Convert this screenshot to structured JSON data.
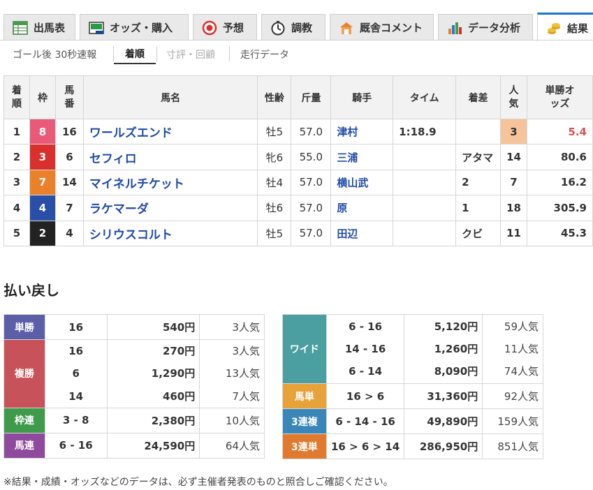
{
  "tabs": [
    {
      "label": "出馬表",
      "icon": "table-icon"
    },
    {
      "label": "オッズ・購入",
      "icon": "ipat-icon"
    },
    {
      "label": "予想",
      "icon": "target-icon"
    },
    {
      "label": "調教",
      "icon": "stopwatch-icon"
    },
    {
      "label": "厩舎コメント",
      "icon": "stable-icon"
    },
    {
      "label": "データ分析",
      "icon": "bar-chart-icon"
    },
    {
      "label": "結果",
      "icon": "coins-icon"
    }
  ],
  "subtabs": [
    "ゴール後 30秒速報",
    "着順",
    "寸評・回顧",
    "走行データ"
  ],
  "result_table": {
    "headers": [
      "着順",
      "枠",
      "馬番",
      "馬名",
      "性齢",
      "斤量",
      "騎手",
      "タイム",
      "着差",
      "人気",
      "単勝オッズ"
    ],
    "rows": [
      {
        "rank": "1",
        "waku": "8",
        "waku_color": "#e85a77",
        "num": "16",
        "name": "ワールズエンド",
        "sexage": "牡5",
        "weight": "57.0",
        "jockey": "津村",
        "time": "1:18.9",
        "margin": "",
        "pop": "3",
        "odds": "5.4"
      },
      {
        "rank": "2",
        "waku": "3",
        "waku_color": "#d9302e",
        "num": "6",
        "name": "セフィロ",
        "sexage": "牝6",
        "weight": "55.0",
        "jockey": "三浦",
        "time": "",
        "margin": "アタマ",
        "pop": "14",
        "odds": "80.6"
      },
      {
        "rank": "3",
        "waku": "7",
        "waku_color": "#e9812a",
        "num": "14",
        "name": "マイネルチケット",
        "sexage": "牡4",
        "weight": "57.0",
        "jockey": "横山武",
        "time": "",
        "margin": "2",
        "pop": "7",
        "odds": "16.2"
      },
      {
        "rank": "4",
        "waku": "4",
        "waku_color": "#2a4fa6",
        "num": "7",
        "name": "ラケマーダ",
        "sexage": "牡6",
        "weight": "57.0",
        "jockey": "原",
        "time": "",
        "margin": "1",
        "pop": "18",
        "odds": "305.9"
      },
      {
        "rank": "5",
        "waku": "2",
        "waku_color": "#222222",
        "num": "4",
        "name": "シリウスコルト",
        "sexage": "牡5",
        "weight": "57.0",
        "jockey": "田辺",
        "time": "",
        "margin": "クビ",
        "pop": "11",
        "odds": "45.3"
      }
    ]
  },
  "payout": {
    "title": "払い戻し",
    "left": [
      {
        "label": "単勝",
        "color": "#5b5fa8",
        "entries": [
          {
            "combo": "16",
            "amount": "540円",
            "pop": "3人気"
          }
        ]
      },
      {
        "label": "複勝",
        "color": "#c8525a",
        "entries": [
          {
            "combo": "16",
            "amount": "270円",
            "pop": "3人気"
          },
          {
            "combo": "6",
            "amount": "1,290円",
            "pop": "13人気"
          },
          {
            "combo": "14",
            "amount": "460円",
            "pop": "7人気"
          }
        ]
      },
      {
        "label": "枠連",
        "color": "#3f9a4b",
        "entries": [
          {
            "combo": "3 - 8",
            "amount": "2,380円",
            "pop": "10人気"
          }
        ]
      },
      {
        "label": "馬連",
        "color": "#8e4a9c",
        "entries": [
          {
            "combo": "6 - 16",
            "amount": "24,590円",
            "pop": "64人気"
          }
        ]
      }
    ],
    "right": [
      {
        "label": "ワイド",
        "color": "#4b9fa0",
        "entries": [
          {
            "combo": "6 - 16",
            "amount": "5,120円",
            "pop": "59人気"
          },
          {
            "combo": "14 - 16",
            "amount": "1,260円",
            "pop": "11人気"
          },
          {
            "combo": "6 - 14",
            "amount": "8,090円",
            "pop": "74人気"
          }
        ]
      },
      {
        "label": "馬単",
        "color": "#e8a23a",
        "entries": [
          {
            "combo": "16 > 6",
            "amount": "31,360円",
            "pop": "92人気"
          }
        ]
      },
      {
        "label": "3連複",
        "color": "#3a86b8",
        "entries": [
          {
            "combo": "6 - 14 - 16",
            "amount": "49,890円",
            "pop": "159人気"
          }
        ]
      },
      {
        "label": "3連単",
        "color": "#e07a2f",
        "entries": [
          {
            "combo": "16 > 6 > 14",
            "amount": "286,950円",
            "pop": "851人気"
          }
        ]
      }
    ]
  },
  "note": "※結果・成績・オッズなどのデータは、必ず主催者発表のものと照合しご確認ください。"
}
